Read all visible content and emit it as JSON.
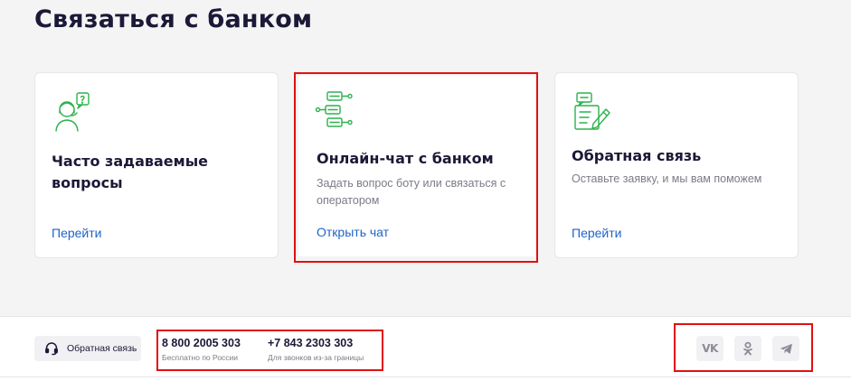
{
  "page": {
    "title": "Связаться с банком"
  },
  "cards": [
    {
      "icon": "faq-person-question-icon",
      "title": "Часто задаваемые вопросы",
      "description": "",
      "link": "Перейти"
    },
    {
      "icon": "chat-bubbles-icon",
      "title": "Онлайн-чат с банком",
      "description": "Задать вопрос боту или связаться с оператором",
      "link": "Открыть чат"
    },
    {
      "icon": "feedback-form-pen-icon",
      "title": "Обратная связь",
      "description": "Оставьте заявку, и мы вам поможем",
      "link": "Перейти"
    }
  ],
  "footer": {
    "feedback_button": "Обратная связь",
    "phones": [
      {
        "number": "8 800 2005 303",
        "note": "Бесплатно по России"
      },
      {
        "number": "+7 843 2303 303",
        "note": "Для звонков из-за границы"
      }
    ],
    "social": [
      {
        "name": "vk",
        "label": "VK"
      },
      {
        "name": "odnoklassniki",
        "label": ""
      },
      {
        "name": "telegram",
        "label": ""
      }
    ]
  },
  "colors": {
    "accent_green": "#2bb24c",
    "link_blue": "#1d64c8",
    "title_dark": "#1b1937",
    "highlight_red": "#e11010"
  }
}
